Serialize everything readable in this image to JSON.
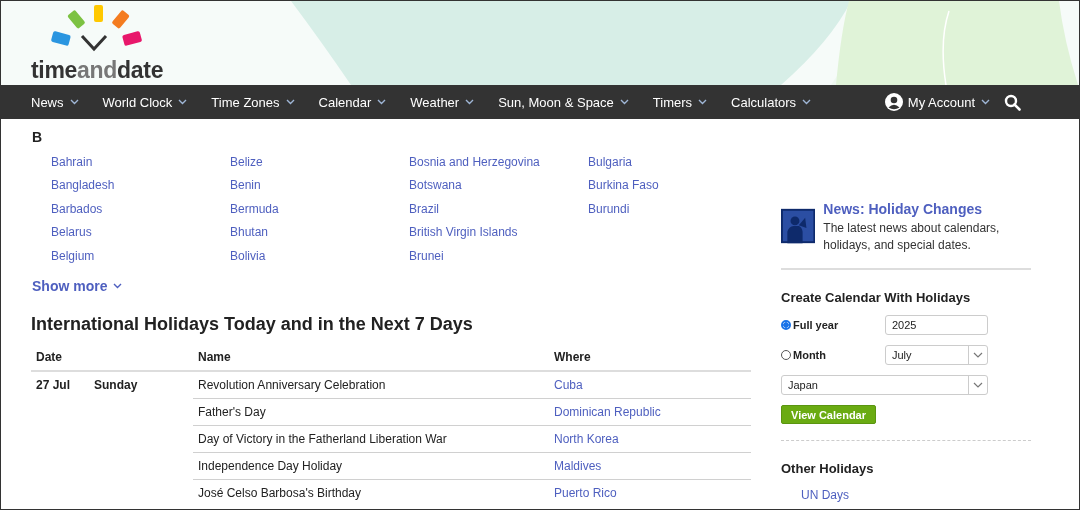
{
  "logo": {
    "words": [
      "time",
      "and",
      "date"
    ]
  },
  "nav": {
    "items": [
      {
        "label": "News"
      },
      {
        "label": "World Clock"
      },
      {
        "label": "Time Zones"
      },
      {
        "label": "Calendar"
      },
      {
        "label": "Weather"
      },
      {
        "label": "Sun, Moon & Space"
      },
      {
        "label": "Timers"
      },
      {
        "label": "Calculators"
      }
    ],
    "account": "My Account"
  },
  "country_index": {
    "letter": "B",
    "columns": [
      [
        "Bahrain",
        "Bangladesh",
        "Barbados",
        "Belarus",
        "Belgium"
      ],
      [
        "Belize",
        "Benin",
        "Bermuda",
        "Bhutan",
        "Bolivia"
      ],
      [
        "Bosnia and Herzegovina",
        "Botswana",
        "Brazil",
        "British Virgin Islands",
        "Brunei"
      ],
      [
        "Bulgaria",
        "Burkina Faso",
        "Burundi"
      ]
    ],
    "show_more": "Show more"
  },
  "holidays": {
    "title": "International Holidays Today and in the Next 7 Days",
    "columns": [
      "Date",
      "Name",
      "Where"
    ],
    "rows": [
      {
        "date": "27 Jul",
        "weekday": "Sunday",
        "name": "Revolution Anniversary Celebration",
        "where": "Cuba"
      },
      {
        "name": "Father's Day",
        "where": "Dominican Republic"
      },
      {
        "name": "Day of Victory in the Fatherland Liberation War",
        "where": "North Korea"
      },
      {
        "name": "Independence Day Holiday",
        "where": "Maldives"
      },
      {
        "name": "José Celso Barbosa's Birthday",
        "where": "Puerto Rico"
      }
    ]
  },
  "sidebar": {
    "news": {
      "title": "News: Holiday Changes",
      "text": "The latest news about calendars, holidays, and special dates."
    },
    "calendar_form": {
      "title": "Create Calendar With Holidays",
      "options": [
        {
          "label": "Full year",
          "selected": true
        },
        {
          "label": "Month",
          "selected": false
        }
      ],
      "year": "2025",
      "month": "July",
      "country": "Japan",
      "button": "View Calendar"
    },
    "other": {
      "title": "Other Holidays",
      "links": [
        "UN Days"
      ]
    }
  }
}
